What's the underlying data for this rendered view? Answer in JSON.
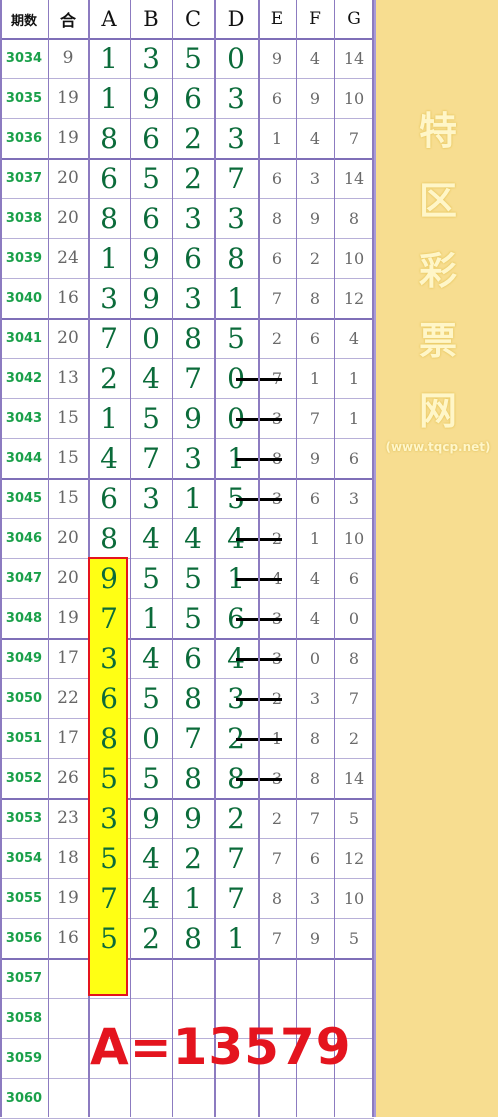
{
  "headers": {
    "period": "期数",
    "sum": "合",
    "a": "A",
    "b": "B",
    "c": "C",
    "d": "D",
    "e": "E",
    "f": "F",
    "g": "G"
  },
  "rows": [
    {
      "period": "3034",
      "sum": "9",
      "a": "1",
      "b": "3",
      "c": "5",
      "d": "0",
      "e": "9",
      "f": "4",
      "g": "14"
    },
    {
      "period": "3035",
      "sum": "19",
      "a": "1",
      "b": "9",
      "c": "6",
      "d": "3",
      "e": "6",
      "f": "9",
      "g": "10"
    },
    {
      "period": "3036",
      "sum": "19",
      "a": "8",
      "b": "6",
      "c": "2",
      "d": "3",
      "e": "1",
      "f": "4",
      "g": "7"
    },
    {
      "period": "3037",
      "sum": "20",
      "a": "6",
      "b": "5",
      "c": "2",
      "d": "7",
      "e": "6",
      "f": "3",
      "g": "14"
    },
    {
      "period": "3038",
      "sum": "20",
      "a": "8",
      "b": "6",
      "c": "3",
      "d": "3",
      "e": "8",
      "f": "9",
      "g": "8"
    },
    {
      "period": "3039",
      "sum": "24",
      "a": "1",
      "b": "9",
      "c": "6",
      "d": "8",
      "e": "6",
      "f": "2",
      "g": "10"
    },
    {
      "period": "3040",
      "sum": "16",
      "a": "3",
      "b": "9",
      "c": "3",
      "d": "1",
      "e": "7",
      "f": "8",
      "g": "12"
    },
    {
      "period": "3041",
      "sum": "20",
      "a": "7",
      "b": "0",
      "c": "8",
      "d": "5",
      "e": "2",
      "f": "6",
      "g": "4"
    },
    {
      "period": "3042",
      "sum": "13",
      "a": "2",
      "b": "4",
      "c": "7",
      "d": "0",
      "e": "7",
      "f": "1",
      "g": "1"
    },
    {
      "period": "3043",
      "sum": "15",
      "a": "1",
      "b": "5",
      "c": "9",
      "d": "0",
      "e": "3",
      "f": "7",
      "g": "1"
    },
    {
      "period": "3044",
      "sum": "15",
      "a": "4",
      "b": "7",
      "c": "3",
      "d": "1",
      "e": "8",
      "f": "9",
      "g": "6"
    },
    {
      "period": "3045",
      "sum": "15",
      "a": "6",
      "b": "3",
      "c": "1",
      "d": "5",
      "e": "3",
      "f": "6",
      "g": "3"
    },
    {
      "period": "3046",
      "sum": "20",
      "a": "8",
      "b": "4",
      "c": "4",
      "d": "4",
      "e": "2",
      "f": "1",
      "g": "10"
    },
    {
      "period": "3047",
      "sum": "20",
      "a": "9",
      "b": "5",
      "c": "5",
      "d": "1",
      "e": "4",
      "f": "4",
      "g": "6"
    },
    {
      "period": "3048",
      "sum": "19",
      "a": "7",
      "b": "1",
      "c": "5",
      "d": "6",
      "e": "3",
      "f": "4",
      "g": "0"
    },
    {
      "period": "3049",
      "sum": "17",
      "a": "3",
      "b": "4",
      "c": "6",
      "d": "4",
      "e": "3",
      "f": "0",
      "g": "8"
    },
    {
      "period": "3050",
      "sum": "22",
      "a": "6",
      "b": "5",
      "c": "8",
      "d": "3",
      "e": "2",
      "f": "3",
      "g": "7"
    },
    {
      "period": "3051",
      "sum": "17",
      "a": "8",
      "b": "0",
      "c": "7",
      "d": "2",
      "e": "1",
      "f": "8",
      "g": "2"
    },
    {
      "period": "3052",
      "sum": "26",
      "a": "5",
      "b": "5",
      "c": "8",
      "d": "8",
      "e": "3",
      "f": "8",
      "g": "14"
    },
    {
      "period": "3053",
      "sum": "23",
      "a": "3",
      "b": "9",
      "c": "9",
      "d": "2",
      "e": "2",
      "f": "7",
      "g": "5"
    },
    {
      "period": "3054",
      "sum": "18",
      "a": "5",
      "b": "4",
      "c": "2",
      "d": "7",
      "e": "7",
      "f": "6",
      "g": "12"
    },
    {
      "period": "3055",
      "sum": "19",
      "a": "7",
      "b": "4",
      "c": "1",
      "d": "7",
      "e": "8",
      "f": "3",
      "g": "10"
    },
    {
      "period": "3056",
      "sum": "16",
      "a": "5",
      "b": "2",
      "c": "8",
      "d": "1",
      "e": "7",
      "f": "9",
      "g": "5"
    },
    {
      "period": "3057",
      "sum": "",
      "a": "",
      "b": "",
      "c": "",
      "d": "",
      "e": "",
      "f": "",
      "g": ""
    },
    {
      "period": "3058",
      "sum": "",
      "a": "",
      "b": "",
      "c": "",
      "d": "",
      "e": "",
      "f": "",
      "g": ""
    },
    {
      "period": "3059",
      "sum": "",
      "a": "",
      "b": "",
      "c": "",
      "d": "",
      "e": "",
      "f": "",
      "g": ""
    },
    {
      "period": "3060",
      "sum": "",
      "a": "",
      "b": "",
      "c": "",
      "d": "",
      "e": "",
      "f": "",
      "g": ""
    }
  ],
  "marked_periods": [
    "3042",
    "3043",
    "3044",
    "3045",
    "3046",
    "3047",
    "3048",
    "3049",
    "3050",
    "3051",
    "3052"
  ],
  "highlighted_periods": [
    "3047",
    "3048",
    "3049",
    "3050",
    "3051",
    "3052",
    "3053",
    "3054",
    "3055",
    "3056",
    "3057"
  ],
  "formula": "A=13579",
  "watermark": {
    "chars": [
      "特",
      "区",
      "彩",
      "票",
      "网"
    ],
    "url": "(www.tqcp.net)"
  },
  "colors": {
    "period": "#1aa04a",
    "big_digit": "#0b6b3a",
    "small_digit": "#6a6a6a",
    "highlight_fill": "#ffff14",
    "highlight_border": "#e4141e",
    "formula": "#e4141e",
    "side_panel": "#f7dd90"
  }
}
